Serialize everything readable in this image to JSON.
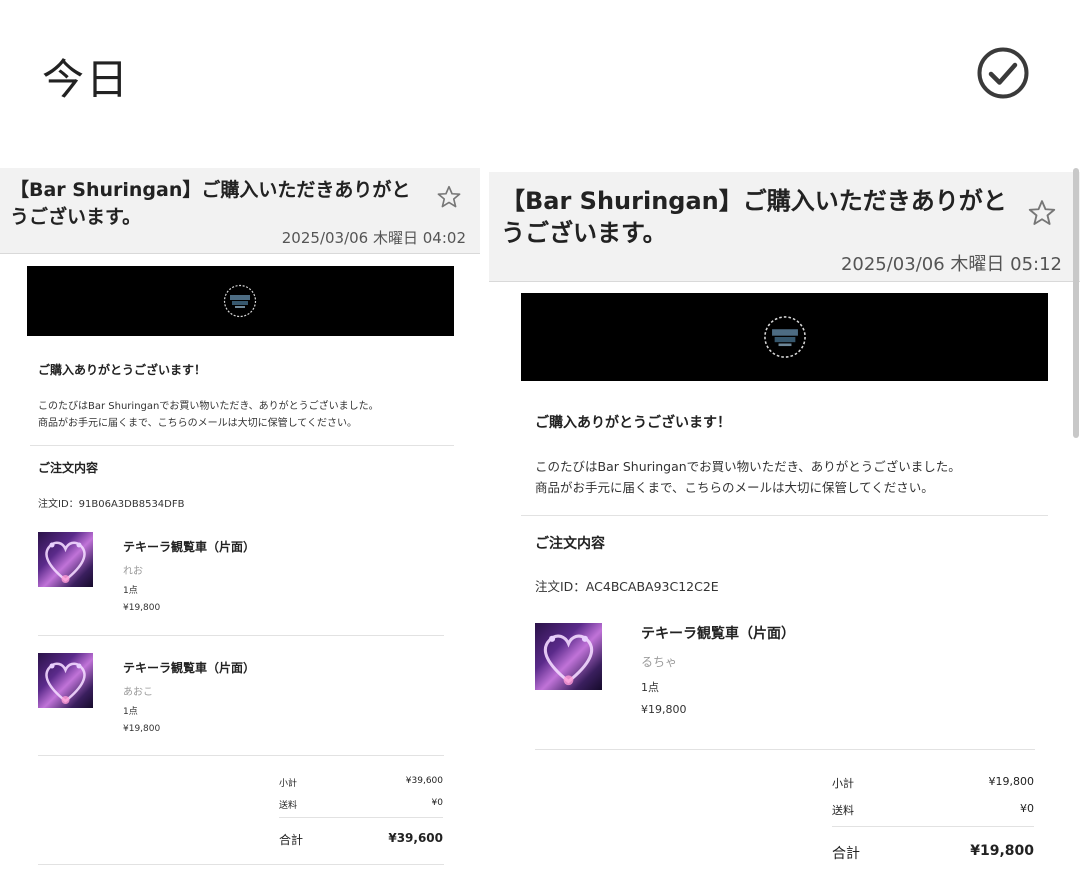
{
  "header": {
    "title": "今日"
  },
  "panels": [
    {
      "subject": "【Bar Shuringan】ご購入いただきありがとうございます。",
      "date": "2025/03/06 木曜日 04:02",
      "thanks_heading": "ご購入ありがとうございます！",
      "message_line1": "このたびはBar Shuringanでお買い物いただき、ありがとうございました。",
      "message_line2": "商品がお手元に届くまで、こちらのメールは大切に保管してください。",
      "order_heading": "ご注文内容",
      "order_id": "注文ID：91B06A3DB8534DFB",
      "items": [
        {
          "name": "テキーラ観覧車（片面）",
          "variant": "れお",
          "qty": "1点",
          "price": "¥19,800"
        },
        {
          "name": "テキーラ観覧車（片面）",
          "variant": "あおこ",
          "qty": "1点",
          "price": "¥19,800"
        }
      ],
      "summary": {
        "subtotal_label": "小計",
        "subtotal": "¥39,600",
        "shipping_label": "送料",
        "shipping": "¥0",
        "total_label": "合計",
        "total": "¥39,600"
      }
    },
    {
      "subject": "【Bar Shuringan】ご購入いただきありがとうございます。",
      "date": "2025/03/06 木曜日 05:12",
      "thanks_heading": "ご購入ありがとうございます！",
      "message_line1": "このたびはBar Shuringanでお買い物いただき、ありがとうございました。",
      "message_line2": "商品がお手元に届くまで、こちらのメールは大切に保管してください。",
      "order_heading": "ご注文内容",
      "order_id": "注文ID：AC4BCABA93C12C2E",
      "items": [
        {
          "name": "テキーラ観覧車（片面）",
          "variant": "るちゃ",
          "qty": "1点",
          "price": "¥19,800"
        }
      ],
      "summary": {
        "subtotal_label": "小計",
        "subtotal": "¥19,800",
        "shipping_label": "送料",
        "shipping": "¥0",
        "total_label": "合計",
        "total": "¥19,800"
      }
    }
  ],
  "icons": {
    "check": "check-circle-icon",
    "star": "star-outline-icon",
    "logo": "bar-logo-icon"
  },
  "colors": {
    "subject_bar_bg": "#f2f2f2",
    "banner_bg": "#000000",
    "variant_text": "#9a9a9a"
  }
}
